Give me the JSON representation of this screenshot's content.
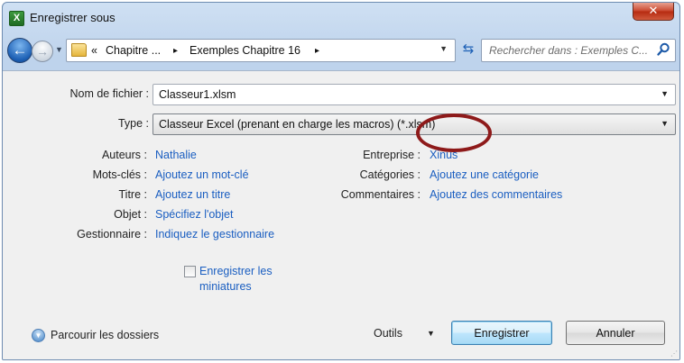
{
  "window": {
    "title": "Enregistrer sous",
    "app_icon_label": "X",
    "close_glyph": "✕"
  },
  "nav": {
    "back_glyph": "←",
    "forward_glyph": "→",
    "history_glyph": "▼",
    "address": {
      "overflow": "«",
      "crumb1": "Chapitre ...",
      "sep1": "▸",
      "crumb2": "Exemples Chapitre 16",
      "sep2": "▸",
      "dropdown_glyph": "▼"
    },
    "refresh_glyph": "⇆",
    "search": {
      "placeholder": "Rechercher dans : Exemples C..."
    }
  },
  "file": {
    "name_label": "Nom de fichier :",
    "name_value": "Classeur1.xlsm",
    "type_label": "Type :",
    "type_value": "Classeur Excel (prenant en charge les macros) (*.xlsm)",
    "dropdown_glyph": "▼"
  },
  "properties": {
    "authors_label": "Auteurs :",
    "authors_value": "Nathalie",
    "tags_label": "Mots-clés :",
    "tags_value": "Ajoutez un mot-clé",
    "title_label": "Titre :",
    "title_value": "Ajoutez un titre",
    "subject_label": "Objet :",
    "subject_value": "Spécifiez l'objet",
    "manager_label": "Gestionnaire :",
    "manager_value": "Indiquez le gestionnaire",
    "company_label": "Entreprise :",
    "company_value": "Xinus",
    "categories_label": "Catégories :",
    "categories_value": "Ajoutez une catégorie",
    "comments_label": "Commentaires :",
    "comments_value": "Ajoutez des commentaires"
  },
  "thumbnails": {
    "checked": false,
    "label_line1": "Enregistrer les",
    "label_line2": "miniatures"
  },
  "footer": {
    "browse_label": "Parcourir les dossiers",
    "browse_glyph": "▼",
    "tools_label": "Outils",
    "tools_glyph": "▼",
    "save_label": "Enregistrer",
    "cancel_label": "Annuler",
    "grip_glyph": "⋰"
  },
  "colors": {
    "link": "#1a5ec1",
    "annotation_circle": "#8e1a1a"
  }
}
